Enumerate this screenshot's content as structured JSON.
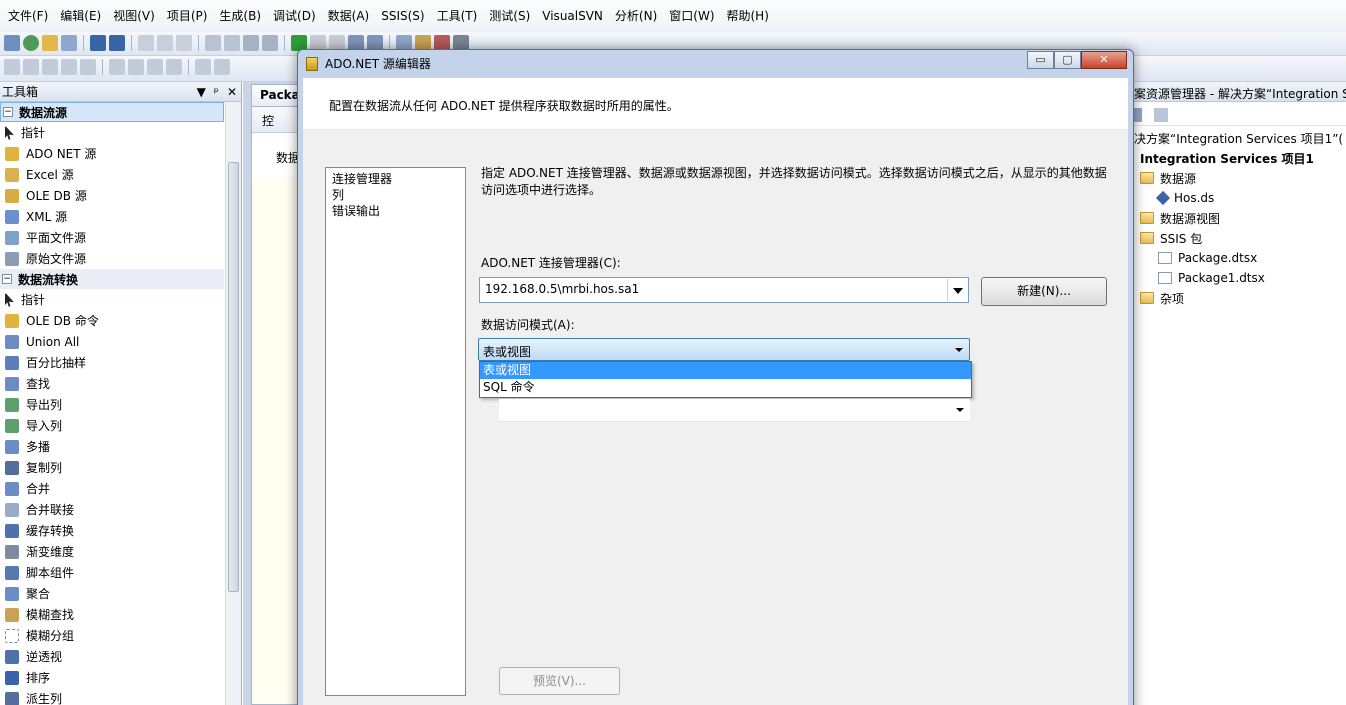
{
  "menubar": {
    "items": [
      "文件(F)",
      "编辑(E)",
      "视图(V)",
      "项目(P)",
      "生成(B)",
      "调试(D)",
      "数据(A)",
      "SSIS(S)",
      "工具(T)",
      "测试(S)",
      "VisualSVN",
      "分析(N)",
      "窗口(W)",
      "帮助(H)"
    ]
  },
  "toolbox": {
    "title": "工具箱",
    "controls": [
      "▼",
      "ᵖ",
      "✕"
    ],
    "category1": "数据流源",
    "sources": [
      "指针",
      "ADO NET 源",
      "Excel 源",
      "OLE DB 源",
      "XML 源",
      "平面文件源",
      "原始文件源"
    ],
    "category2": "数据流转换",
    "transforms": [
      "指针",
      "OLE DB 命令",
      "Union All",
      "百分比抽样",
      "查找",
      "导出列",
      "导入列",
      "多播",
      "复制列",
      "合并",
      "合并联接",
      "缓存转换",
      "渐变维度",
      "脚本组件",
      "聚合",
      "模糊查找",
      "模糊分组",
      "逆透视",
      "排序",
      "派生列"
    ]
  },
  "designer": {
    "tab_label": "Packa",
    "subtab_label": "控",
    "canvas_label": "数据"
  },
  "solution": {
    "title": "案资源管理器 - 解决方案“Integration S",
    "solution_label": "决方案“Integration Services 项目1”(",
    "project": "Integration Services 项目1",
    "nodes": [
      "数据源",
      "Hos.ds",
      "数据源视图",
      "SSIS 包",
      "Package.dtsx",
      "Package1.dtsx",
      "杂项"
    ]
  },
  "dialog": {
    "title": "ADO.NET 源编辑器",
    "window_buttons": [
      "▭",
      "▢",
      "✕"
    ],
    "intro": "配置在数据流从任何 ADO.NET 提供程序获取数据时所用的属性。",
    "nav": [
      "连接管理器",
      "列",
      "错误输出"
    ],
    "description": "指定 ADO.NET 连接管理器、数据源或数据源视图，并选择数据访问模式。选择数据访问模式之后，从显示的其他数据访问选项中进行选择。",
    "connection_label": "ADO.NET 连接管理器(C):",
    "connection_value": "192.168.0.5\\mrbi.hos.sa1",
    "new_button": "新建(N)...",
    "mode_label": "数据访问模式(A):",
    "mode_value": "表或视图",
    "mode_options": [
      "表或视图",
      "SQL 命令"
    ],
    "preview_button": "预览(V)..."
  },
  "colors": {
    "selection": "#3399ff",
    "dialog_frame": "#c3d3e9"
  }
}
